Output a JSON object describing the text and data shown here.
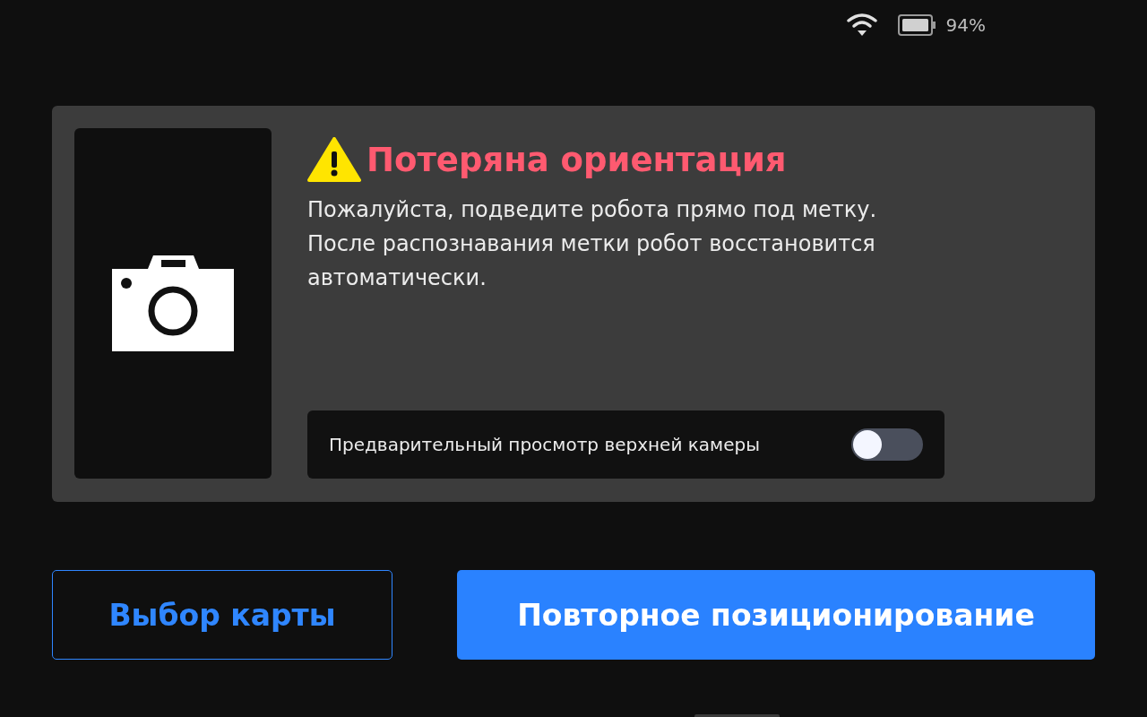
{
  "status_bar": {
    "battery": "94%"
  },
  "alert": {
    "title": "Потеряна ориентация",
    "message": [
      "Пожалуйста, подведите робота прямо под метку.",
      "После распознавания метки робот восстановится автоматически."
    ],
    "camera_preview": {
      "label": "Предварительный просмотр верхней камеры",
      "on": false
    }
  },
  "buttons": [
    {
      "label": "Выбор карты",
      "kind": "secondary"
    },
    {
      "label": "Повторное позиционирование",
      "kind": "primary"
    }
  ]
}
